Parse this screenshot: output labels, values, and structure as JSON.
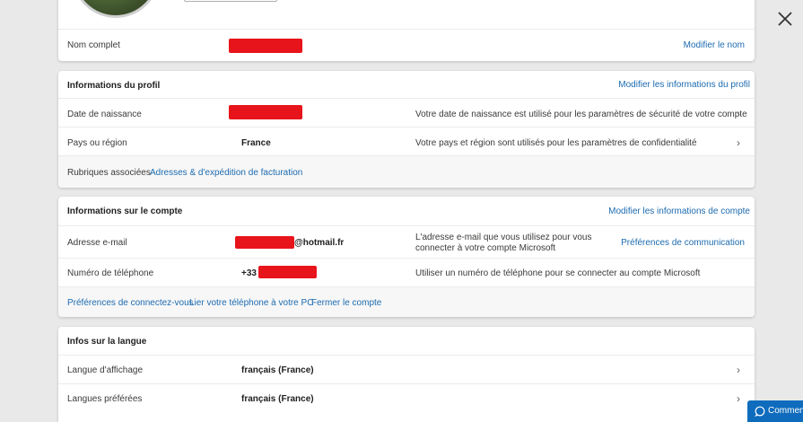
{
  "close": {
    "icon": "close-icon"
  },
  "name_card": {
    "label": "Nom complet",
    "edit_link": "Modifier le nom"
  },
  "profile": {
    "title": "Informations du profil",
    "edit_link": "Modifier les informations du profil",
    "rows": [
      {
        "label": "Date de naissance",
        "value": "",
        "description": "Votre date de naissance est utilisé pour les paramètres de sécurité de votre compte"
      },
      {
        "label": "Pays ou région",
        "value": "France",
        "description": "Votre pays et région sont utilisés pour les paramètres de confidentialité"
      }
    ],
    "related_label": "Rubriques associées",
    "related_link": "Adresses & d'expédition de facturation"
  },
  "account": {
    "title": "Informations sur le compte",
    "edit_link": "Modifier les informations de compte",
    "email_label": "Adresse e-mail",
    "email_suffix": "@hotmail.fr",
    "email_desc_line1": "L'adresse e-mail que vous utilisez pour vous",
    "email_desc_line2": "connecter à votre compte Microsoft",
    "email_link": "Préférences de communication",
    "phone_label": "Numéro de téléphone",
    "phone_prefix": "+33",
    "phone_desc": "Utiliser un numéro de téléphone pour se connecter au compte Microsoft",
    "footer_links": [
      "Préférences de connectez-vous",
      "Lier votre téléphone à votre PC",
      "Fermer le compte"
    ]
  },
  "language": {
    "title": "Infos sur la langue",
    "rows": [
      {
        "label": "Langue d'affichage",
        "value": "français (France)"
      },
      {
        "label": "Langues préférées",
        "value": "français (France)"
      }
    ]
  },
  "feedback": {
    "label": "Commen",
    "icon": "comment-icon"
  },
  "colors": {
    "link": "#1c6bb0",
    "redaction": "#e8141b",
    "feedback_bg": "#0f6cbd"
  }
}
